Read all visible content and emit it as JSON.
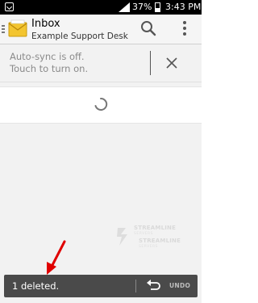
{
  "status_bar": {
    "battery_percent": "37%",
    "battery_level": 0.37,
    "time": "3:43 PM",
    "icons": [
      "notification-icon",
      "signal-icon",
      "battery-icon"
    ]
  },
  "action_bar": {
    "title": "Inbox",
    "account": "Example Support Desk",
    "icons": [
      "nav-drawer-icon",
      "mail-app-icon",
      "search-icon",
      "overflow-menu-icon"
    ]
  },
  "sync_banner": {
    "line1": "Auto-sync is off.",
    "line2": "Touch to turn on.",
    "close_icon": "close-icon"
  },
  "content": {
    "loading_icon": "spinner-icon",
    "watermark_brand": "STREAMLINE",
    "watermark_sub": "SERVERS"
  },
  "undo_bar": {
    "message": "1 deleted.",
    "action_label": "UNDO",
    "action_icon": "undo-icon"
  },
  "colors": {
    "status_bar": "#000000",
    "action_bar": "#f5f5f5",
    "snackbar": "#4a4a4a",
    "annotation": "#e00000",
    "app_icon": "#f0c030"
  }
}
